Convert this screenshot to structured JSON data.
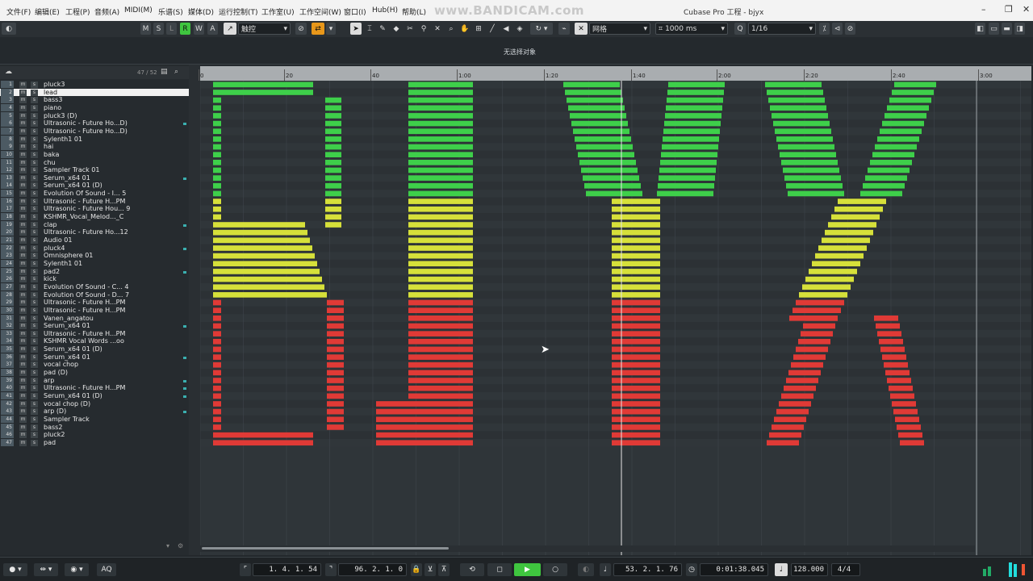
{
  "menu": [
    "文件(F)",
    "编辑(E)",
    "工程(P)",
    "音频(A)",
    "MIDI(M)",
    "乐谱(S)",
    "媒体(D)",
    "运行控制(T)",
    "工作室(U)",
    "工作空间(W)",
    "窗口(I)",
    "Hub(H)",
    "帮助(L)"
  ],
  "watermark": "www.BANDICAM.com",
  "window_title": "Cubase Pro 工程 - bjyx",
  "toolbar": {
    "m": "M",
    "s": "S",
    "l": "L",
    "r": "R",
    "w": "W",
    "a": "A",
    "automation_mode": "触控",
    "snap_type": "网格",
    "grid_time": "1000 ms",
    "quantize": "1/16"
  },
  "info_line": "无选择对象",
  "track_count": "47 / 52",
  "tracks": [
    "pluck3",
    "lead",
    "bass3",
    "piano",
    "pluck3 (D)",
    "Ultrasonic - Future Ho...D)",
    "Ultrasonic - Future Ho...D)",
    "Sylenth1 01",
    "hai",
    "baka",
    "chu",
    "Sampler Track 01",
    "Serum_x64 01",
    "Serum_x64 01 (D)",
    "Evolution Of Sound - I... 5",
    "Ultrasonic - Future H...PM",
    "Ultrasonic - Future Hou... 9",
    "KSHMR_Vocal_Melod..._C",
    "clap",
    "Ultrasonic - Future Ho...12",
    "Audio 01",
    "pluck4",
    "Omnisphere 01",
    "Sylenth1 01",
    "pad2",
    "kick",
    "Evolution Of Sound - C... 4",
    "Evolution Of Sound - D... 7",
    "Ultrasonic - Future H...PM",
    "Ultrasonic - Future H...PM",
    "Vanen_angatou",
    "Serum_x64 01",
    "Ultrasonic - Future H...PM",
    "KSHMR Vocal Words ...oo",
    "Serum_x64 01 (D)",
    "Serum_x64 01",
    "vocal chop",
    "pad (D)",
    "arp",
    "Ultrasonic - Future H...PM",
    "Serum_x64 01 (D)",
    "vocal chop (D)",
    "arp (D)",
    "Sampler Track",
    "bass2",
    "pluck2",
    "pad"
  ],
  "ruler_labels": [
    "0",
    "20",
    "40",
    "1:00",
    "1:20",
    "1:40",
    "2:00",
    "2:20",
    "2:40",
    "3:00"
  ],
  "transport": {
    "left_locator": "1. 4. 1. 54",
    "right_locator": "96. 2. 1. 0",
    "position": "53. 2. 1. 76",
    "time": "0:01:38.045",
    "tempo": "128.000",
    "signature": "4/4",
    "aq": "AQ"
  },
  "colors": {
    "green": "#3ecf4a",
    "yellow": "#d6e03a",
    "red": "#e03a36"
  }
}
